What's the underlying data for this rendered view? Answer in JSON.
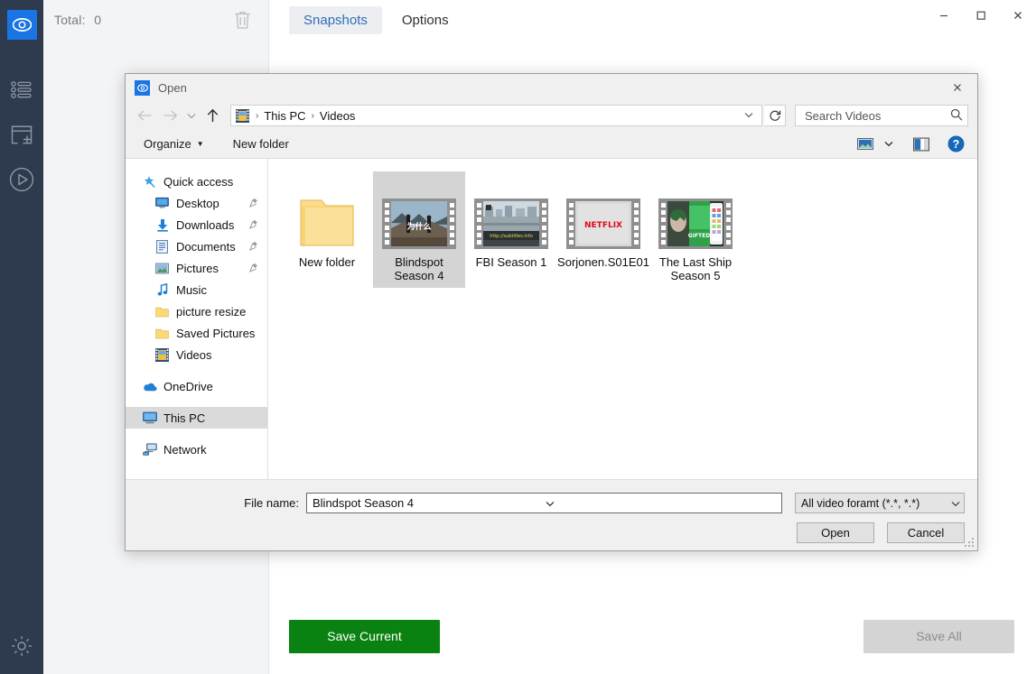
{
  "app": {
    "sidebar_icons": [
      "eye-logo",
      "list-icon",
      "add-panel-icon",
      "play-icon",
      "gear-icon"
    ],
    "total_label": "Total:",
    "total_value": "0",
    "trash_icon": "trash-icon",
    "tabs": [
      {
        "label": "Snapshots",
        "active": true
      },
      {
        "label": "Options",
        "active": false
      }
    ],
    "window_controls": {
      "minimize": "–",
      "maximize": "☐",
      "close": "✕"
    },
    "buttons": {
      "save_current": "Save Current",
      "save_all": "Save All"
    },
    "colors": {
      "accent": "#1975e4",
      "sidebar": "#2e3a4e",
      "save_current": "#0a8211",
      "save_all": "#d4d4d4",
      "tab_active_text": "#2f6fb5"
    }
  },
  "dialog": {
    "title": "Open",
    "title_icon": "eye-icon",
    "close_icon": "close-icon",
    "nav": {
      "back_icon": "arrow-left-icon",
      "forward_icon": "arrow-right-icon",
      "history_icon": "chevron-down-icon",
      "up_icon": "arrow-up-icon",
      "refresh_icon": "refresh-icon",
      "path_icon": "video-folder-icon",
      "breadcrumbs": [
        "This PC",
        "Videos"
      ],
      "separator": "›"
    },
    "search": {
      "placeholder": "Search Videos",
      "value": "",
      "icon": "search-icon"
    },
    "toolbar": {
      "organize": "Organize",
      "organize_caret": "▼",
      "new_folder": "New folder",
      "view_icon": "view-layout-icon",
      "view_caret": "▾",
      "preview_pane_icon": "preview-pane-icon",
      "help_icon": "help-icon"
    },
    "nav_pane": [
      {
        "label": "Quick access",
        "icon": "star-pin-icon",
        "indent": false,
        "pin": false,
        "selected": false
      },
      {
        "label": "Desktop",
        "icon": "desktop-icon",
        "indent": true,
        "pin": true,
        "selected": false
      },
      {
        "label": "Downloads",
        "icon": "download-icon",
        "indent": true,
        "pin": true,
        "selected": false
      },
      {
        "label": "Documents",
        "icon": "documents-icon",
        "indent": true,
        "pin": true,
        "selected": false
      },
      {
        "label": "Pictures",
        "icon": "pictures-icon",
        "indent": true,
        "pin": true,
        "selected": false
      },
      {
        "label": "Music",
        "icon": "music-note-icon",
        "indent": true,
        "pin": false,
        "selected": false
      },
      {
        "label": "picture resize",
        "icon": "folder-icon",
        "indent": true,
        "pin": false,
        "selected": false
      },
      {
        "label": "Saved Pictures",
        "icon": "folder-icon",
        "indent": true,
        "pin": false,
        "selected": false
      },
      {
        "label": "Videos",
        "icon": "video-folder-icon",
        "indent": true,
        "pin": false,
        "selected": false
      },
      {
        "label": "OneDrive",
        "icon": "cloud-icon",
        "indent": false,
        "pin": false,
        "selected": false,
        "gap_before": true
      },
      {
        "label": "This PC",
        "icon": "computer-icon",
        "indent": false,
        "pin": false,
        "selected": true,
        "gap_before": true
      },
      {
        "label": "Network",
        "icon": "network-icon",
        "indent": false,
        "pin": false,
        "selected": false,
        "gap_before": true
      }
    ],
    "files": [
      {
        "label": "New folder",
        "type": "folder",
        "selected": false
      },
      {
        "label": "Blindspot Season 4",
        "type": "video",
        "selected": true,
        "thumb": "mountain-scene"
      },
      {
        "label": "FBI Season 1",
        "type": "video",
        "selected": false,
        "thumb": "cityscape"
      },
      {
        "label": "Sorjonen.S01E01",
        "type": "video",
        "selected": false,
        "thumb": "netflix-logo",
        "thumb_text": "NETFLIX"
      },
      {
        "label": "The Last Ship Season 5",
        "type": "video",
        "selected": false,
        "thumb": "gifted-poster",
        "thumb_text": "GIFTED"
      }
    ],
    "footer": {
      "filename_label": "File name:",
      "filename_value": "Blindspot Season 4",
      "filter_value": "All video foramt (*.*, *.*)",
      "open_button": "Open",
      "cancel_button": "Cancel",
      "caret": "∨"
    }
  }
}
